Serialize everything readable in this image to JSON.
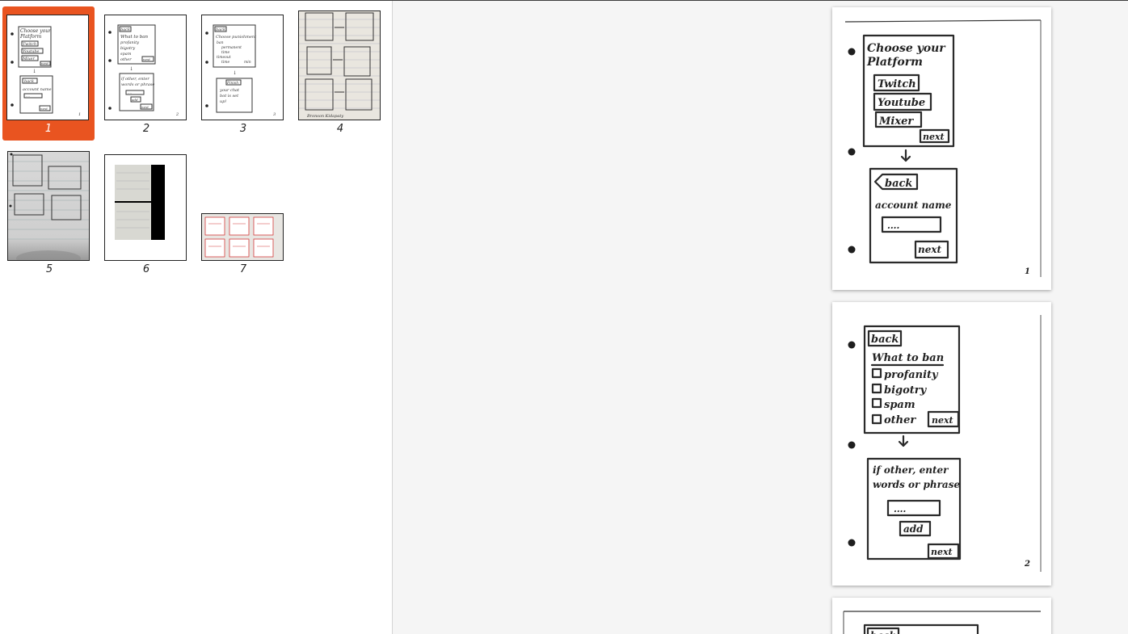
{
  "sidebar": {
    "thumbnails": [
      {
        "label": "1",
        "selected": true
      },
      {
        "label": "2",
        "selected": false
      },
      {
        "label": "3",
        "selected": false
      },
      {
        "label": "4",
        "selected": false
      },
      {
        "label": "5",
        "selected": false
      },
      {
        "label": "6",
        "selected": false
      },
      {
        "label": "7",
        "selected": false
      }
    ]
  },
  "thumb1": {
    "title1": "Choose your",
    "title2": "Platform",
    "opt1": "Twitch",
    "opt2": "Youtube",
    "opt3": "Mixer",
    "next": "next",
    "back": "back",
    "account": "account name",
    "dots": "....",
    "next2": "next",
    "num": "1"
  },
  "thumb2": {
    "back": "back",
    "heading": "What to ban",
    "c1": "profanity",
    "c2": "bigotry",
    "c3": "spam",
    "c4": "other",
    "next": "next",
    "hint1": "if other, enter",
    "hint2": "words or phrase",
    "dots": "....",
    "add": "add",
    "next2": "next",
    "num": "2"
  },
  "thumb3": {
    "back": "back",
    "heading": "Choose punishment",
    "o1": "ban",
    "o2": "permanent",
    "o3": "time",
    "o4": "timeout",
    "o5": "time",
    "unit": "min",
    "finish": "Finish",
    "t1": "your chat",
    "t2": "bot is set",
    "t3": "up!",
    "num": "3"
  },
  "thumb4": {
    "credit": "Bronson Kidapaty"
  },
  "page1": {
    "title1": "Choose your",
    "title2": "Platform",
    "opt1": "Twitch",
    "opt2": "Youtube",
    "opt3": "Mixer",
    "next": "next",
    "back": "back",
    "account": "account name",
    "dots": "....",
    "next2": "next",
    "num": "1"
  },
  "page2": {
    "back": "back",
    "heading": "What to ban",
    "c1": "profanity",
    "c2": "bigotry",
    "c3": "spam",
    "c4": "other",
    "next": "next",
    "hint1": "if other, enter",
    "hint2": "words or phrase",
    "dots": "....",
    "add": "add",
    "next2": "next",
    "num": "2"
  },
  "page3": {
    "back": "back"
  },
  "colors": {
    "selection": "#e95420",
    "accent_red": "#d23b3b"
  }
}
